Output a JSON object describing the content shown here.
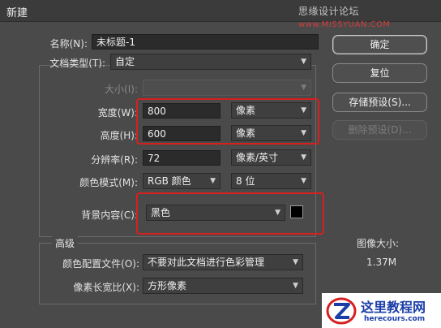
{
  "window": {
    "title": "新建"
  },
  "watermark": {
    "site_cn": "思缘设计论坛",
    "site_en": "www.MISSYUAN.COM"
  },
  "form": {
    "name": {
      "label": "名称(N):",
      "value": "未标题-1"
    },
    "doc_type": {
      "label": "文档类型(T):",
      "value": "自定"
    },
    "size": {
      "label": "大小(I):",
      "value": ""
    },
    "width": {
      "label": "宽度(W):",
      "value": "800",
      "unit": "像素"
    },
    "height": {
      "label": "高度(H):",
      "value": "600",
      "unit": "像素"
    },
    "resolution": {
      "label": "分辨率(R):",
      "value": "72",
      "unit": "像素/英寸"
    },
    "color_mode": {
      "label": "颜色模式(M):",
      "value": "RGB 颜色",
      "bits": "8 位"
    },
    "background": {
      "label": "背景内容(C):",
      "value": "黑色",
      "swatch_color": "#000000"
    }
  },
  "advanced": {
    "title": "高级",
    "color_profile": {
      "label": "颜色配置文件(O):",
      "value": "不要对此文档进行色彩管理"
    },
    "pixel_aspect": {
      "label": "像素长宽比(X):",
      "value": "方形像素"
    }
  },
  "buttons": {
    "ok": "确定",
    "reset": "复位",
    "save_preset": "存储预设(S)...",
    "delete_preset": "删除预设(D)..."
  },
  "image_size": {
    "label": "图像大小:",
    "value": "1.37M"
  },
  "logo": {
    "title": "这里教程网",
    "url": "herecours.com"
  },
  "colors": {
    "highlight": "#d62020",
    "dialog_bg": "#4a4a4a"
  }
}
